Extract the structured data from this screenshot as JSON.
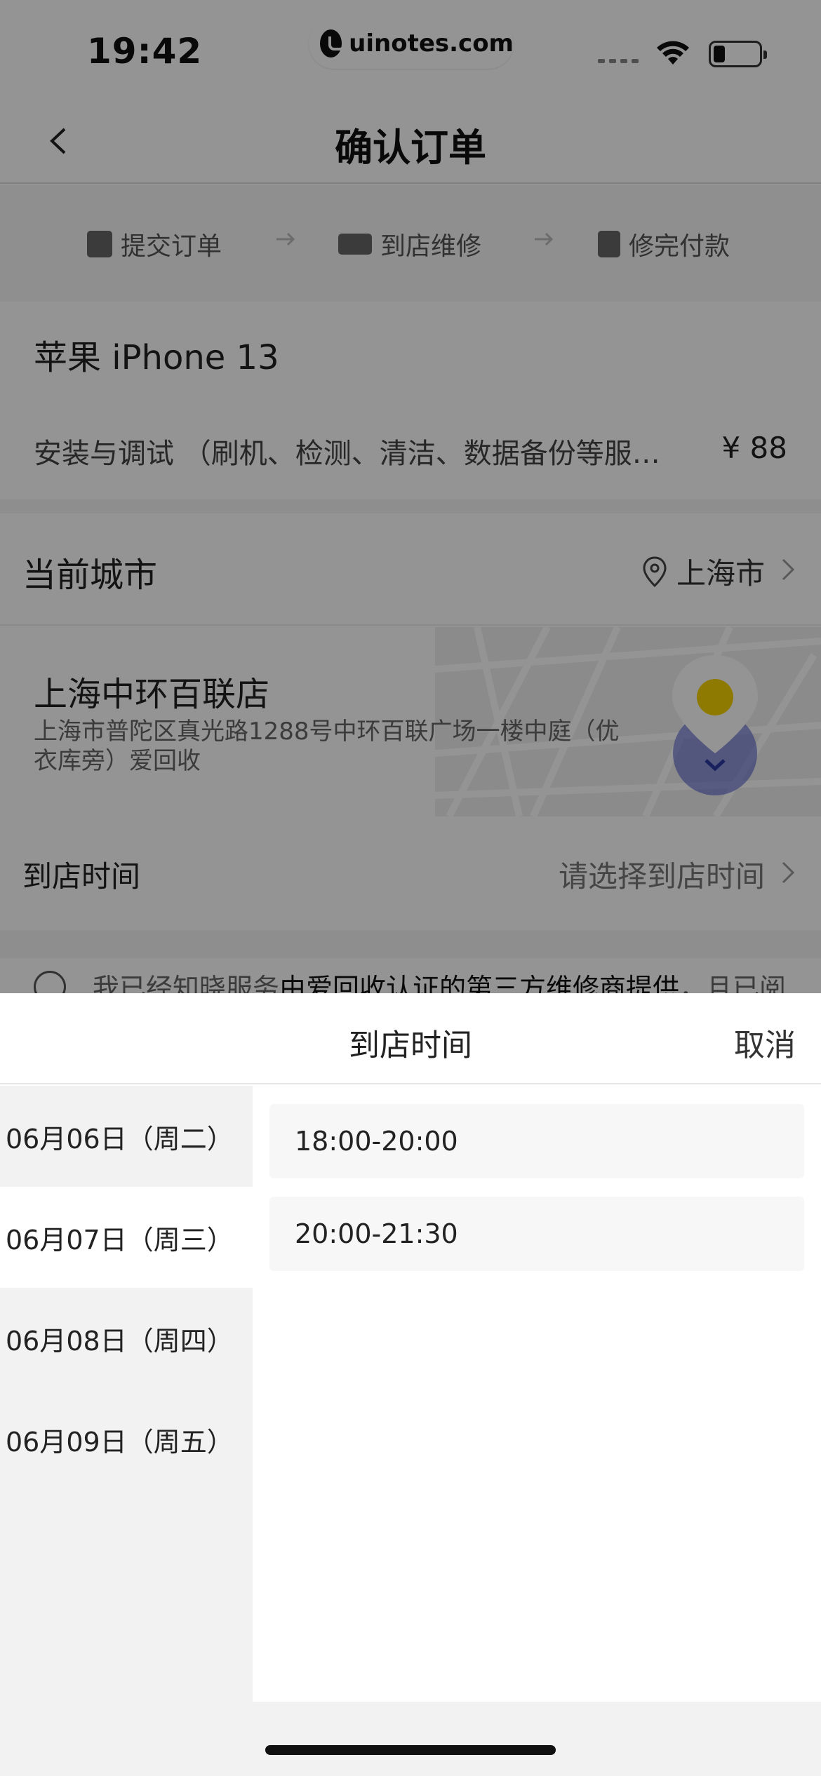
{
  "status_bar": {
    "time": "19:42",
    "url": "uinotes.com"
  },
  "nav": {
    "title": "确认订单"
  },
  "steps": [
    {
      "label": "提交订单",
      "icon": "clipboard-check-icon"
    },
    {
      "label": "到店维修",
      "icon": "truck-icon"
    },
    {
      "label": "修完付款",
      "icon": "yuan-shield-icon"
    }
  ],
  "product": {
    "name": "苹果 iPhone 13",
    "service": "安装与调试 （刷机、检测、清洁、数据备份等服…",
    "price": "¥ 88"
  },
  "city": {
    "label": "当前城市",
    "value": "上海市"
  },
  "store": {
    "name": "上海中环百联店",
    "address": "上海市普陀区真光路1288号中环百联广场一楼中庭（优衣库旁）爱回收"
  },
  "visit_time": {
    "label": "到店时间",
    "placeholder": "请选择到店时间"
  },
  "agreement": {
    "prefix": "我已经知晓服务",
    "strong": "由爱回收认证的第三方维修商提供",
    "suffix": "，且已阅"
  },
  "sheet": {
    "title": "到店时间",
    "cancel": "取消",
    "dates": [
      {
        "label": "06月06日（周二）",
        "selected": false
      },
      {
        "label": "06月07日（周三）",
        "selected": true
      },
      {
        "label": "06月08日（周四）",
        "selected": false
      },
      {
        "label": "06月09日（周五）",
        "selected": false
      }
    ],
    "slots": [
      "18:00-20:00",
      "20:00-21:30"
    ]
  },
  "colors": {
    "overlay": "rgba(0,0,0,0.42)",
    "sheet_bg": "#ffffff",
    "date_col_bg": "#f2f2f2",
    "slot_bg": "#f7f7f7",
    "map_pin": "#f5d300"
  }
}
